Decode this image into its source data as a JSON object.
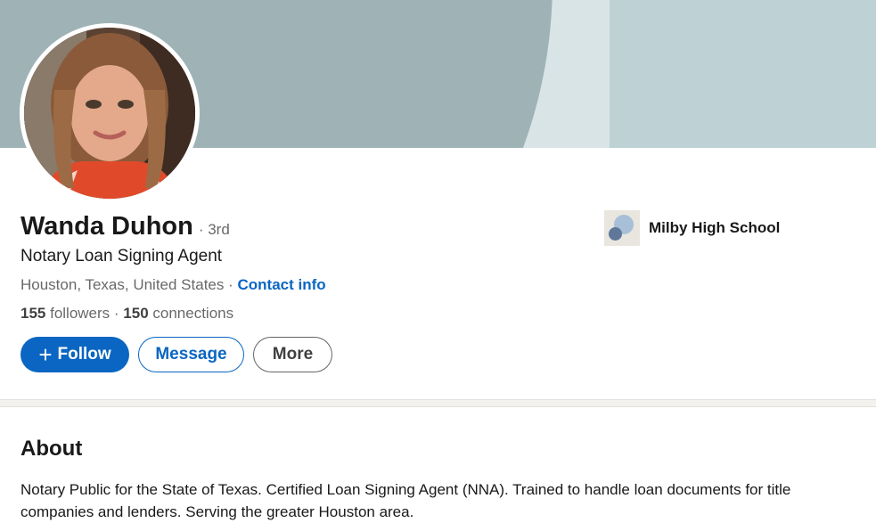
{
  "profile": {
    "name": "Wanda Duhon",
    "degree": "· 3rd",
    "headline": "Notary Loan Signing Agent",
    "location": "Houston, Texas, United States",
    "separator": " · ",
    "contact_info": "Contact info",
    "followers_count": "155",
    "followers_label": " followers",
    "connections_sep": " · ",
    "connections_count": "150",
    "connections_label": " connections"
  },
  "actions": {
    "follow_icon": "+",
    "follow_label": "Follow",
    "message_label": "Message",
    "more_label": "More"
  },
  "education": {
    "school": "Milby High School"
  },
  "about": {
    "title": "About",
    "text": "Notary Public for the State of Texas. Certified Loan Signing Agent (NNA). Trained to handle loan documents for title companies and lenders. Serving the greater Houston area."
  },
  "colors": {
    "brand_blue": "#0a66c2",
    "banner_dark": "#9fb3b6",
    "banner_light": "#d9e4e6",
    "banner_right": "#bed2d6"
  }
}
